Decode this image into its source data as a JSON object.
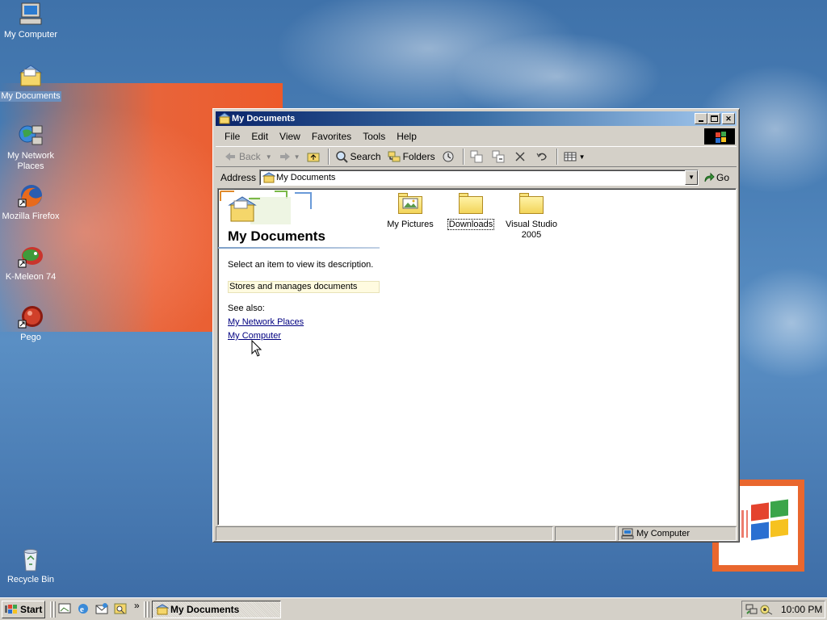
{
  "desktop": {
    "icons": [
      {
        "label": "My Computer",
        "icon": "computer-icon"
      },
      {
        "label": "My Documents",
        "icon": "documents-folder-icon",
        "selected": true
      },
      {
        "label": "My Network Places",
        "icon": "network-places-icon"
      },
      {
        "label": "Mozilla Firefox",
        "icon": "firefox-icon"
      },
      {
        "label": "K-Meleon 74",
        "icon": "k-meleon-icon"
      },
      {
        "label": "Pego",
        "icon": "pego-icon"
      },
      {
        "label": "Recycle Bin",
        "icon": "recycle-bin-icon"
      }
    ]
  },
  "window": {
    "title": "My Documents",
    "menu": [
      "File",
      "Edit",
      "View",
      "Favorites",
      "Tools",
      "Help"
    ],
    "toolbar": {
      "back": "Back",
      "search": "Search",
      "folders": "Folders"
    },
    "address": {
      "label": "Address",
      "value": "My Documents",
      "go": "Go"
    },
    "pane": {
      "title": "My Documents",
      "prompt": "Select an item to view its description.",
      "description": "Stores and manages documents",
      "see_also": "See also:",
      "links": [
        "My Network Places",
        "My Computer"
      ]
    },
    "files": [
      {
        "label": "My Pictures",
        "icon": "pictures-folder-icon"
      },
      {
        "label": "Downloads",
        "icon": "folder-icon",
        "selected": true
      },
      {
        "label": "Visual Studio 2005",
        "icon": "folder-icon"
      }
    ],
    "status": {
      "zone": "My Computer"
    }
  },
  "taskbar": {
    "start": "Start",
    "task": "My Documents",
    "clock": "10:00 PM"
  },
  "colors": {
    "title_active": "#0a246a",
    "title_gradient_end": "#a6caf0",
    "desktop": "#3f72aa",
    "face": "#d4d0c8",
    "link": "#000080"
  }
}
